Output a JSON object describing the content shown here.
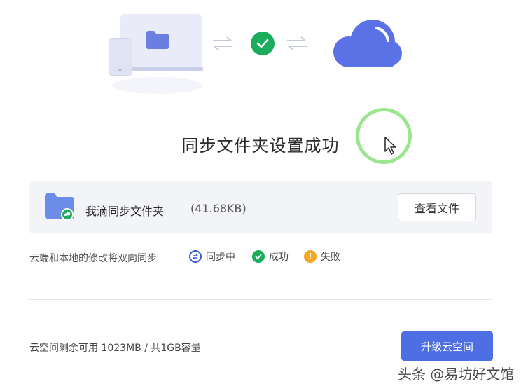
{
  "dialog": {
    "title": "同步文件夹设置成功"
  },
  "folder": {
    "name": "我滴同步文件夹",
    "size": "(41.68KB)",
    "view_button": "查看文件"
  },
  "sync_info": {
    "note": "云端和本地的修改将双向同步",
    "legend": [
      {
        "label": "同步中",
        "color": "#3b5bd8",
        "icon": "syncing-icon"
      },
      {
        "label": "成功",
        "color": "#1aad5b",
        "icon": "success-check-icon"
      },
      {
        "label": "失败",
        "color": "#f5a623",
        "icon": "failure-warning-icon"
      }
    ]
  },
  "storage": {
    "text": "云空间剩余可用 1023MB / 共1GB容量",
    "upgrade_button": "升级云空间"
  },
  "watermark": "头条 @易坊好文馆",
  "colors": {
    "accent": "#4e6fe3",
    "success": "#1aad5b",
    "warning": "#f5a623",
    "cloud": "#5b72e6"
  }
}
